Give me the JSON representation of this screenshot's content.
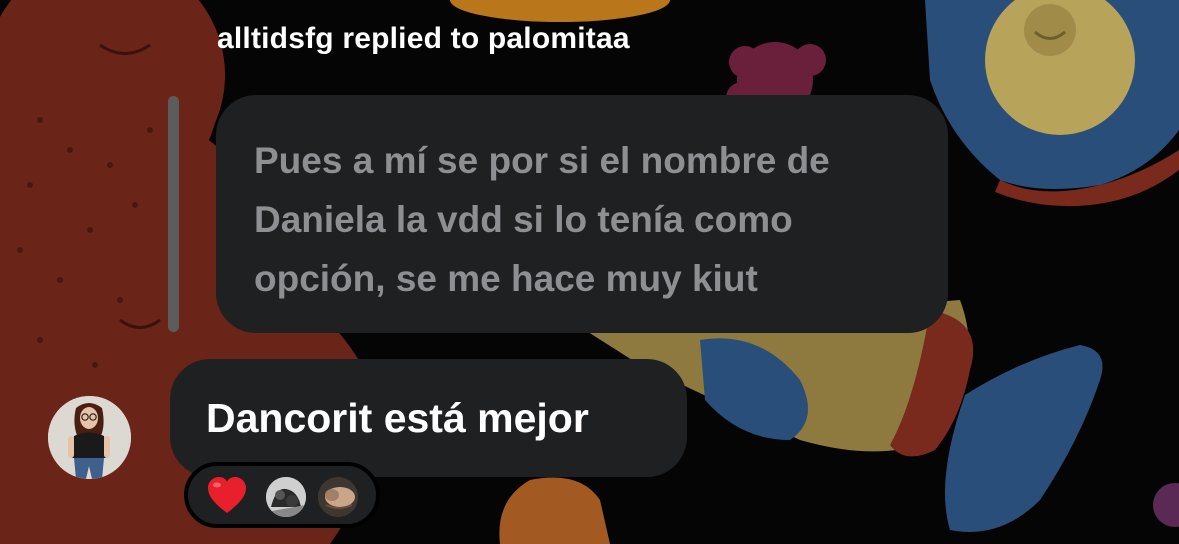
{
  "thread": {
    "reply_header": "alltidsfg replied to palomitaa",
    "quoted_message": {
      "lines": [
        "Pues a mí se por si el nombre de",
        "Daniela la vdd si lo tenía como",
        "opción, se me hace muy kiut"
      ]
    },
    "message": {
      "text": "Dancorit está mejor"
    },
    "reactions": {
      "emoji": "heart-icon",
      "reactor_count_shown": 2
    }
  },
  "colors": {
    "background": "#000000",
    "bubble": "#1f2022",
    "quoted_text": "#8e8f93",
    "message_text": "#ffffff",
    "heart": "#e8202c"
  }
}
